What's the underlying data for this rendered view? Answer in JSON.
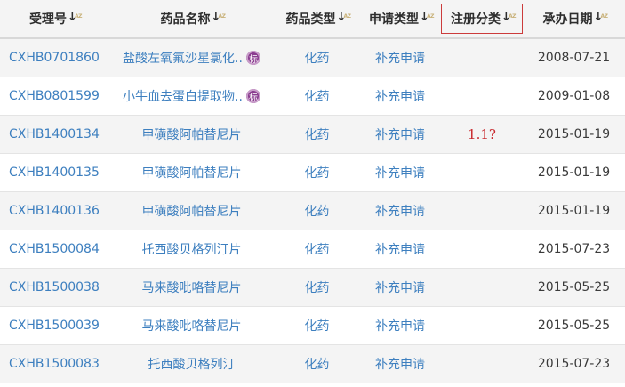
{
  "table": {
    "headers": {
      "id": "受理号",
      "name": "药品名称",
      "drug_type": "药品类型",
      "app_type": "申请类型",
      "reg_class": "注册分类",
      "date": "承办日期"
    },
    "sort_glyphs": {
      "arrow": "↓",
      "az": "AZ"
    },
    "badge_text": "标",
    "rows": [
      {
        "id": "CXHB0701860",
        "name": "盐酸左氧氟沙星氯化..",
        "badge": true,
        "drug_type": "化药",
        "app_type": "补充申请",
        "reg_class": "",
        "date": "2008-07-21"
      },
      {
        "id": "CXHB0801599",
        "name": "小牛血去蛋白提取物..",
        "badge": true,
        "drug_type": "化药",
        "app_type": "补充申请",
        "reg_class": "",
        "date": "2009-01-08"
      },
      {
        "id": "CXHB1400134",
        "name": "甲磺酸阿帕替尼片",
        "badge": false,
        "drug_type": "化药",
        "app_type": "补充申请",
        "reg_class": "1.1?",
        "date": "2015-01-19"
      },
      {
        "id": "CXHB1400135",
        "name": "甲磺酸阿帕替尼片",
        "badge": false,
        "drug_type": "化药",
        "app_type": "补充申请",
        "reg_class": "",
        "date": "2015-01-19"
      },
      {
        "id": "CXHB1400136",
        "name": "甲磺酸阿帕替尼片",
        "badge": false,
        "drug_type": "化药",
        "app_type": "补充申请",
        "reg_class": "",
        "date": "2015-01-19"
      },
      {
        "id": "CXHB1500084",
        "name": "托西酸贝格列汀片",
        "badge": false,
        "drug_type": "化药",
        "app_type": "补充申请",
        "reg_class": "",
        "date": "2015-07-23"
      },
      {
        "id": "CXHB1500038",
        "name": "马来酸吡咯替尼片",
        "badge": false,
        "drug_type": "化药",
        "app_type": "补充申请",
        "reg_class": "",
        "date": "2015-05-25"
      },
      {
        "id": "CXHB1500039",
        "name": "马来酸吡咯替尼片",
        "badge": false,
        "drug_type": "化药",
        "app_type": "补充申请",
        "reg_class": "",
        "date": "2015-05-25"
      },
      {
        "id": "CXHB1500083",
        "name": "托西酸贝格列汀",
        "badge": false,
        "drug_type": "化药",
        "app_type": "补充申请",
        "reg_class": "",
        "date": "2015-07-23"
      }
    ]
  },
  "colors": {
    "link": "#3d7fbf",
    "header_bg": "#f4f4f4",
    "highlight_border": "#cc3b3b",
    "annotation_text": "#c8282d",
    "badge": "#8a3c8f"
  }
}
